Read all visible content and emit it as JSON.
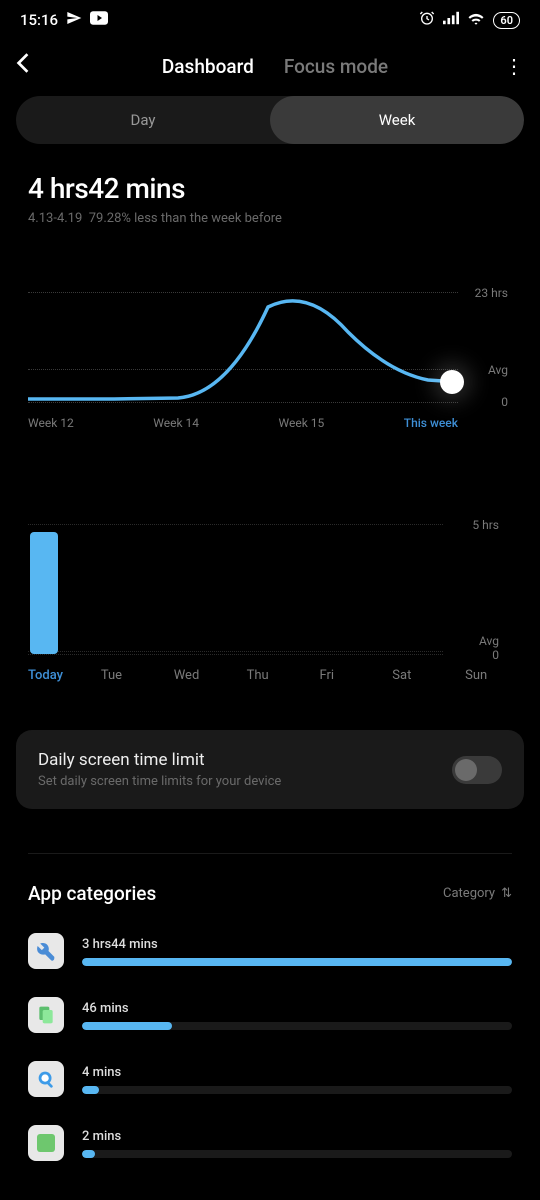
{
  "status": {
    "time": "15:16",
    "battery": "60"
  },
  "header": {
    "tabs": [
      "Dashboard",
      "Focus mode"
    ],
    "activeTab": 0
  },
  "segment": {
    "options": [
      "Day",
      "Week"
    ],
    "active": 1
  },
  "summary": {
    "time": "4 hrs42 mins",
    "range": "4.13-4.19",
    "compare": "79.28% less than the week before"
  },
  "chart_data": [
    {
      "type": "line",
      "title": "",
      "xlabel": "",
      "ylabel": "",
      "x_labels": [
        "Week 12",
        "Week 14",
        "Week 15",
        "This week"
      ],
      "ylim": [
        0,
        23
      ],
      "avg_line": 7,
      "max_label": "23 hrs",
      "avg_label": "Avg",
      "zero_label": "0",
      "values": [
        1,
        1,
        2,
        22,
        9,
        5
      ]
    },
    {
      "type": "bar",
      "title": "",
      "xlabel": "",
      "ylabel": "",
      "categories": [
        "Today",
        "Tue",
        "Wed",
        "Thu",
        "Fri",
        "Sat",
        "Sun"
      ],
      "ylim": [
        0,
        5
      ],
      "max_label": "5 hrs",
      "avg_label": "Avg",
      "zero_label": "0",
      "values": [
        4.7,
        0,
        0,
        0,
        0,
        0,
        0
      ]
    }
  ],
  "limit": {
    "title": "Daily screen time limit",
    "subtitle": "Set daily screen time limits for your device",
    "enabled": false
  },
  "categories": {
    "title": "App categories",
    "sort_label": "Category",
    "items": [
      {
        "icon": "wrench",
        "time_label": "3 hrs44 mins",
        "pct": 100,
        "color": "#e8e8e8",
        "icon_color": "#4a8cd6"
      },
      {
        "icon": "pages",
        "time_label": "46 mins",
        "pct": 21,
        "color": "#e8e8e8",
        "icon_color": "#5cbf6e"
      },
      {
        "icon": "search-doc",
        "time_label": "4 mins",
        "pct": 4,
        "color": "#e8e8e8",
        "icon_color": "#3d9be8"
      },
      {
        "icon": "square",
        "time_label": "2 mins",
        "pct": 2,
        "color": "#e8e8e8",
        "icon_color": "#6ec76e"
      }
    ]
  }
}
